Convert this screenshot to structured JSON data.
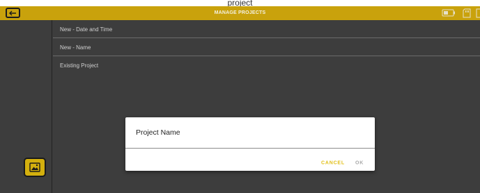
{
  "caption": "project",
  "header": {
    "title": "MANAGE PROJECTS"
  },
  "projects_menu": {
    "items": [
      {
        "label": "New - Date and Time"
      },
      {
        "label": "New - Name"
      },
      {
        "label": "Existing Project"
      }
    ]
  },
  "dialog": {
    "title": "Project Name",
    "input_value": "",
    "cancel_label": "CANCEL",
    "ok_label": "OK"
  },
  "icons": {
    "back": "back-arrow-icon",
    "battery": "battery-icon",
    "sd_card": "sd-card-icon",
    "gallery": "gallery-icon"
  },
  "colors": {
    "header": "#c9a20c",
    "background": "#3d3d3d",
    "accent": "#e2c01a",
    "disabled": "#a8a8a8"
  }
}
